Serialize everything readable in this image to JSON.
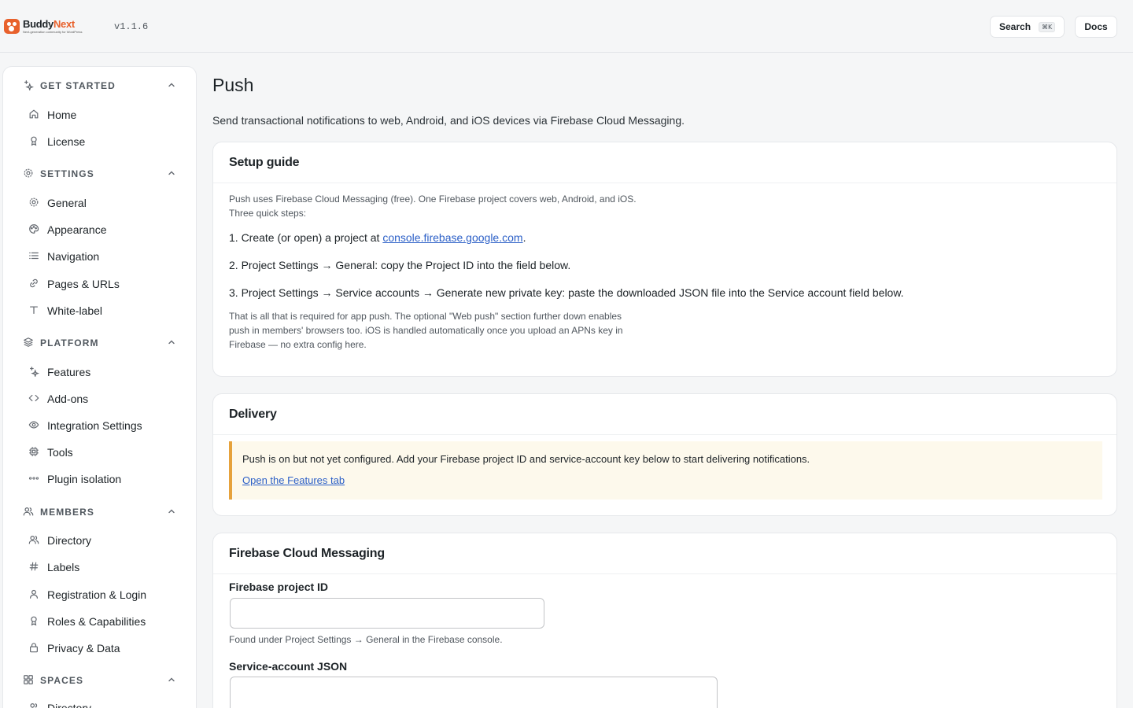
{
  "app": {
    "logo_word_a": "Buddy",
    "logo_word_b": "Next",
    "logo_tagline": "Next-generation community for WordPress",
    "version": "v1.1.6"
  },
  "topbar": {
    "search_label": "Search",
    "search_shortcut": "⌘K",
    "docs_label": "Docs"
  },
  "sidebar": {
    "sections": [
      {
        "title": "GET STARTED",
        "icon": "sparkles-icon",
        "items": [
          {
            "label": "Home",
            "icon": "home-icon"
          },
          {
            "label": "License",
            "icon": "award-icon"
          }
        ]
      },
      {
        "title": "SETTINGS",
        "icon": "gear-icon",
        "items": [
          {
            "label": "General",
            "icon": "gear-icon"
          },
          {
            "label": "Appearance",
            "icon": "palette-icon"
          },
          {
            "label": "Navigation",
            "icon": "list-icon"
          },
          {
            "label": "Pages & URLs",
            "icon": "link-icon"
          },
          {
            "label": "White-label",
            "icon": "type-icon"
          }
        ]
      },
      {
        "title": "PLATFORM",
        "icon": "layers-icon",
        "items": [
          {
            "label": "Features",
            "icon": "sparkles-icon"
          },
          {
            "label": "Add-ons",
            "icon": "code-icon"
          },
          {
            "label": "Integration Settings",
            "icon": "eye-icon"
          },
          {
            "label": "Tools",
            "icon": "cpu-icon"
          },
          {
            "label": "Plugin isolation",
            "icon": "dots-icon"
          }
        ]
      },
      {
        "title": "MEMBERS",
        "icon": "users-icon",
        "items": [
          {
            "label": "Directory",
            "icon": "users-icon"
          },
          {
            "label": "Labels",
            "icon": "hash-icon"
          },
          {
            "label": "Registration & Login",
            "icon": "user-icon"
          },
          {
            "label": "Roles & Capabilities",
            "icon": "award-icon"
          },
          {
            "label": "Privacy & Data",
            "icon": "lock-icon"
          }
        ]
      },
      {
        "title": "SPACES",
        "icon": "grid-icon",
        "items": [
          {
            "label": "Directory",
            "icon": "users-icon"
          }
        ]
      }
    ]
  },
  "main": {
    "title": "Push",
    "description": "Send transactional notifications to web, Android, and iOS devices via Firebase Cloud Messaging.",
    "setup": {
      "title": "Setup guide",
      "intro_line1": "Push uses Firebase Cloud Messaging (free). One Firebase project covers web, Android, and iOS.",
      "intro_line2": "Three quick steps:",
      "step1_prefix": "1. Create (or open) a project at ",
      "step1_link": "console.firebase.google.com",
      "step1_suffix": ".",
      "step2": "2. Project Settings → General: copy the Project ID into the field below.",
      "step3": "3. Project Settings → Service accounts → Generate new private key: paste the downloaded JSON file into the Service account field below.",
      "outro_line1": "That is all that is required for app push. The optional \"Web push\" section further down enables",
      "outro_line2": "push in members' browsers too. iOS is handled automatically once you upload an APNs key in",
      "outro_line3": "Firebase — no extra config here."
    },
    "delivery": {
      "title": "Delivery",
      "notice": "Push is on but not yet configured. Add your Firebase project ID and service-account key below to start delivering notifications.",
      "notice_link": "Open the Features tab"
    },
    "fcm": {
      "title": "Firebase Cloud Messaging",
      "project_id_label": "Firebase project ID",
      "project_id_value": "",
      "project_id_help": "Found under Project Settings → General in the Firebase console.",
      "service_account_label": "Service-account JSON",
      "service_account_value": ""
    }
  },
  "colors": {
    "brand": "#e8612c",
    "link": "#2b5fc7",
    "notice_border": "#e6a23c",
    "notice_bg": "#fdf9ec"
  }
}
